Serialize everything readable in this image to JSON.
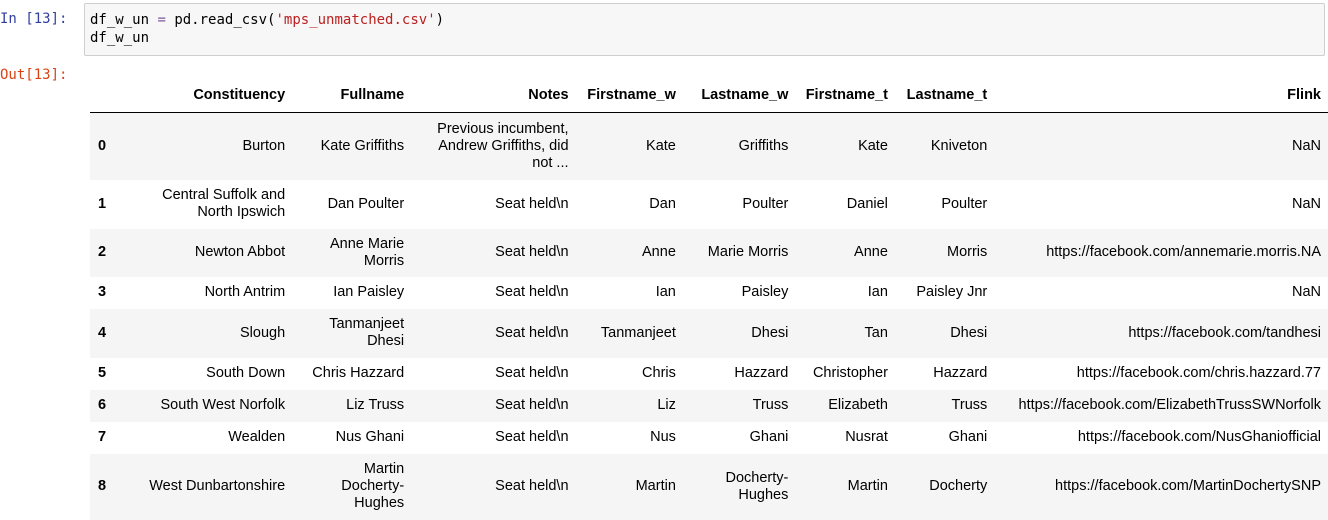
{
  "notebook": {
    "in_prompt": "In [13]:",
    "out_prompt": "Out[13]:",
    "code": {
      "var": "df_w_un",
      "op": "=",
      "call": "pd.read_csv(",
      "arg": "'mps_unmatched.csv'",
      "close": ")",
      "line2": "df_w_un"
    }
  },
  "table": {
    "columns": [
      "",
      "Constituency",
      "Fullname",
      "Notes",
      "Firstname_w",
      "Lastname_w",
      "Firstname_t",
      "Lastname_t",
      "Flink"
    ],
    "rows": [
      {
        "index": "0",
        "constituency": "Burton",
        "fullname": "Kate Griffiths",
        "notes": "Previous incumbent, Andrew Griffiths, did not ...",
        "firstname_w": "Kate",
        "lastname_w": "Griffiths",
        "firstname_t": "Kate",
        "lastname_t": "Kniveton",
        "flink": "NaN"
      },
      {
        "index": "1",
        "constituency": "Central Suffolk and North Ipswich",
        "fullname": "Dan Poulter",
        "notes": "Seat held\\n",
        "firstname_w": "Dan",
        "lastname_w": "Poulter",
        "firstname_t": "Daniel",
        "lastname_t": "Poulter",
        "flink": "NaN"
      },
      {
        "index": "2",
        "constituency": "Newton Abbot",
        "fullname": "Anne Marie Morris",
        "notes": "Seat held\\n",
        "firstname_w": "Anne",
        "lastname_w": "Marie Morris",
        "firstname_t": "Anne",
        "lastname_t": "Morris",
        "flink": "https://facebook.com/annemarie.morris.NA"
      },
      {
        "index": "3",
        "constituency": "North Antrim",
        "fullname": "Ian Paisley",
        "notes": "Seat held\\n",
        "firstname_w": "Ian",
        "lastname_w": "Paisley",
        "firstname_t": "Ian",
        "lastname_t": "Paisley Jnr",
        "flink": "NaN"
      },
      {
        "index": "4",
        "constituency": "Slough",
        "fullname": "Tanmanjeet Dhesi",
        "notes": "Seat held\\n",
        "firstname_w": "Tanmanjeet",
        "lastname_w": "Dhesi",
        "firstname_t": "Tan",
        "lastname_t": "Dhesi",
        "flink": "https://facebook.com/tandhesi"
      },
      {
        "index": "5",
        "constituency": "South Down",
        "fullname": "Chris Hazzard",
        "notes": "Seat held\\n",
        "firstname_w": "Chris",
        "lastname_w": "Hazzard",
        "firstname_t": "Christopher",
        "lastname_t": "Hazzard",
        "flink": "https://facebook.com/chris.hazzard.77"
      },
      {
        "index": "6",
        "constituency": "South West Norfolk",
        "fullname": "Liz Truss",
        "notes": "Seat held\\n",
        "firstname_w": "Liz",
        "lastname_w": "Truss",
        "firstname_t": "Elizabeth",
        "lastname_t": "Truss",
        "flink": "https://facebook.com/ElizabethTrussSWNorfolk"
      },
      {
        "index": "7",
        "constituency": "Wealden",
        "fullname": "Nus Ghani",
        "notes": "Seat held\\n",
        "firstname_w": "Nus",
        "lastname_w": "Ghani",
        "firstname_t": "Nusrat",
        "lastname_t": "Ghani",
        "flink": "https://facebook.com/NusGhaniofficial"
      },
      {
        "index": "8",
        "constituency": "West Dunbartonshire",
        "fullname": "Martin Docherty-Hughes",
        "notes": "Seat held\\n",
        "firstname_w": "Martin",
        "lastname_w": "Docherty-Hughes",
        "firstname_t": "Martin",
        "lastname_t": "Docherty",
        "flink": "https://facebook.com/MartinDochertySNP"
      }
    ]
  }
}
